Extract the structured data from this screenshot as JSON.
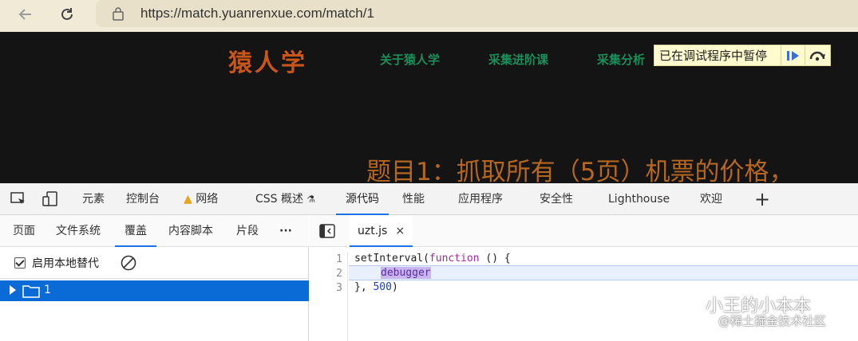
{
  "browser": {
    "url": "https://match.yuanrenxue.com/match/1"
  },
  "page": {
    "logo": "猿人学",
    "nav": [
      "关于猿人学",
      "采集进阶课",
      "采集分析"
    ],
    "paused_label": "已在调试程序中暂停",
    "headline": "题目1：抓取所有（5页）机票的价格，"
  },
  "devtools": {
    "tabs": {
      "elements": "元素",
      "console": "控制台",
      "network": "网络",
      "css_overview": "CSS 概述",
      "sources": "源代码",
      "performance": "性能",
      "application": "应用程序",
      "security": "安全性",
      "lighthouse": "Lighthouse",
      "welcome": "欢迎"
    },
    "navigator": {
      "tabs": [
        "页面",
        "文件系统",
        "覆盖",
        "内容脚本",
        "片段"
      ],
      "more": "···",
      "enable_overrides": "启用本地替代",
      "folder": "1"
    },
    "editor": {
      "file": "uzt.js",
      "close": "×",
      "line_numbers": [
        "1",
        "2",
        "3"
      ],
      "line1_fn": "setInterval(",
      "line1_kw": "function",
      "line1_rest": " () {",
      "line2": "debugger",
      "line3_a": "}, ",
      "line3_num": "500",
      "line3_b": ")"
    }
  },
  "watermark": {
    "title": "小王的小本本",
    "sub": "@稀土掘金技术社区"
  },
  "colors": {
    "accent": "#1a73e8",
    "logo": "#c8561a",
    "nav_link": "#1a8f5a",
    "selected_row": "#0b6bd6"
  }
}
